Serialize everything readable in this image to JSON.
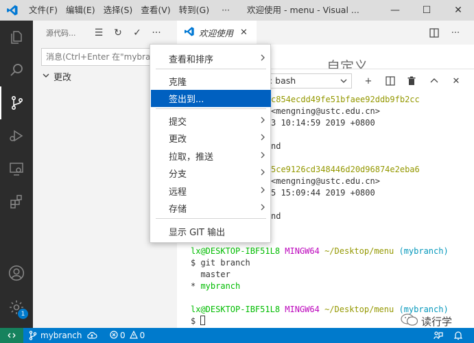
{
  "titlebar": {
    "menus": [
      "文件(F)",
      "编辑(E)",
      "选择(S)",
      "查看(V)",
      "转到(G)"
    ],
    "more": "···",
    "title": "欢迎使用 - menu - Visual ...",
    "controls": {
      "minimize": "—",
      "maximize": "☐",
      "close": "✕"
    }
  },
  "activitybar": {
    "items": [
      "files-icon",
      "search-icon",
      "source-control-icon",
      "debug-icon",
      "remote-explorer-icon",
      "extensions-icon"
    ],
    "bottom": [
      "account-icon",
      "settings-icon"
    ],
    "settings_badge": "1"
  },
  "sidebar": {
    "title": "源代码...",
    "actions": [
      "☰",
      "↻",
      "✓",
      "···"
    ],
    "message_placeholder": "消息(Ctrl+Enter 在\"mybranch\"提交)",
    "group_label": "更改"
  },
  "tabs": [
    {
      "label": "欢迎使用",
      "close": "✕"
    }
  ],
  "editor": {
    "welcome_peek": "自定义"
  },
  "panel": {
    "terminal_select": "1: bash",
    "actions": [
      "+",
      "split",
      "trash",
      "^",
      "✕"
    ]
  },
  "terminal": {
    "lines": [
      {
        "segments": [
          {
            "text": "c854ecdd49fe51bfaee92ddb9fb2cc",
            "color": "yel"
          }
        ],
        "indent": 117
      },
      {
        "segments": [
          {
            "text": "<mengning@ustc.edu.cn>",
            "color": ""
          }
        ],
        "indent": 117
      },
      {
        "segments": [
          {
            "text": "3 10:14:59 2019 +0800",
            "color": ""
          }
        ],
        "indent": 117
      },
      {
        "segments": [
          {
            "text": "nd",
            "color": ""
          }
        ],
        "indent": 117
      },
      {
        "segments": [
          {
            "text": "5ce9126cd348446d20d96874e2eba6",
            "color": "yel"
          }
        ],
        "indent": 117
      },
      {
        "segments": [
          {
            "text": "<mengning@ustc.edu.cn>",
            "color": ""
          }
        ],
        "indent": 117
      },
      {
        "segments": [
          {
            "text": "5 15:09:44 2019 +0800",
            "color": ""
          }
        ],
        "indent": 117
      },
      {
        "segments": [
          {
            "text": "nd",
            "color": ""
          }
        ],
        "indent": 117
      },
      {
        "segments": [
          {
            "text": "lx@DESKTOP-IBF51L8",
            "color": "grn"
          },
          {
            "text": " MINGW64",
            "color": "mag"
          },
          {
            "text": " ~/Desktop/menu",
            "color": "yel"
          },
          {
            "text": " (mybranch)",
            "color": "cyn"
          }
        ],
        "indent": 0
      },
      {
        "segments": [
          {
            "text": "$ git branch",
            "color": ""
          }
        ],
        "indent": 0
      },
      {
        "segments": [
          {
            "text": "  master",
            "color": ""
          }
        ],
        "indent": 0
      },
      {
        "segments": [
          {
            "text": "* ",
            "color": ""
          },
          {
            "text": "mybranch",
            "color": "grn"
          }
        ],
        "indent": 0
      },
      {
        "segments": [
          {
            "text": "lx@DESKTOP-IBF51L8",
            "color": "grn"
          },
          {
            "text": " MINGW64",
            "color": "mag"
          },
          {
            "text": " ~/Desktop/menu",
            "color": "yel"
          },
          {
            "text": " (mybranch)",
            "color": "cyn"
          }
        ],
        "indent": 0
      },
      {
        "segments": [
          {
            "text": "$ ",
            "color": ""
          }
        ],
        "indent": 0,
        "cursor": true
      }
    ]
  },
  "context_menu": {
    "items": [
      {
        "label": "查看和排序",
        "submenu": true
      },
      {
        "label": "克隆",
        "submenu": false
      },
      {
        "label": "签出到...",
        "submenu": false,
        "selected": true
      },
      {
        "label": "提交",
        "submenu": true
      },
      {
        "label": "更改",
        "submenu": true
      },
      {
        "label": "拉取，推送",
        "submenu": true
      },
      {
        "label": "分支",
        "submenu": true
      },
      {
        "label": "远程",
        "submenu": true
      },
      {
        "label": "存储",
        "submenu": true
      },
      {
        "label": "显示 GIT 输出",
        "submenu": false
      }
    ]
  },
  "statusbar": {
    "branch": "mybranch",
    "errors": "0",
    "warnings": "0"
  },
  "watermark": {
    "text": "读行学"
  },
  "colors": {
    "accent": "#007acc",
    "activity_bg": "#2c2c2c",
    "menu_selected": "#0060c0",
    "remote": "#16825d"
  }
}
